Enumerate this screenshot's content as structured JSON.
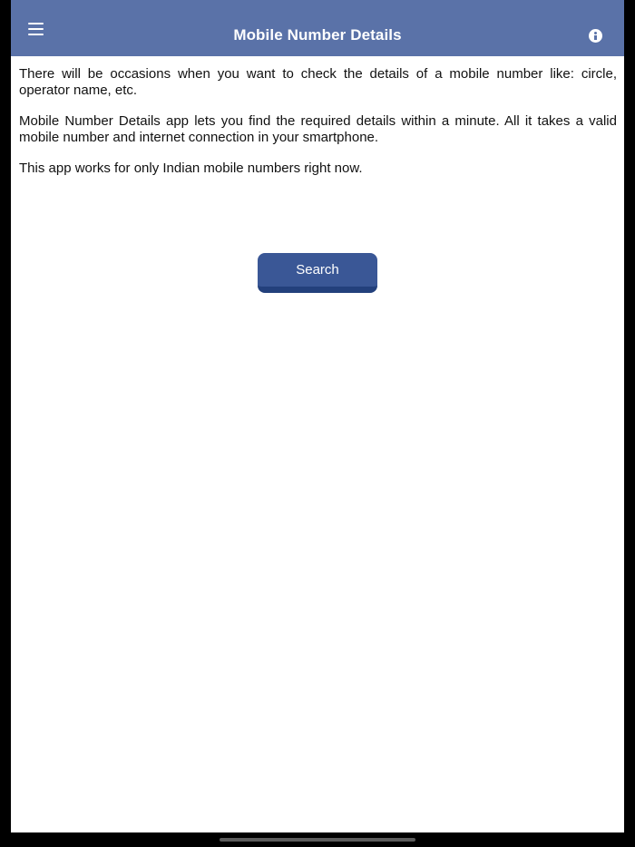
{
  "header": {
    "title": "Mobile Number Details",
    "menu_icon": "hamburger-menu-icon",
    "info_icon": "info-icon"
  },
  "content": {
    "paragraphs": [
      "There will be occasions when you want to check the details of a mobile number like: circle, operator name, etc.",
      "Mobile Number Details app lets you find the required details within a minute. All it takes a valid mobile number and internet connection in your smartphone.",
      "This app works for only Indian mobile numbers right now."
    ]
  },
  "actions": {
    "search_label": "Search"
  },
  "colors": {
    "navbar": "#5a72a8",
    "button": "#3a5796",
    "button_shadow": "#23407c",
    "background": "#ffffff"
  }
}
